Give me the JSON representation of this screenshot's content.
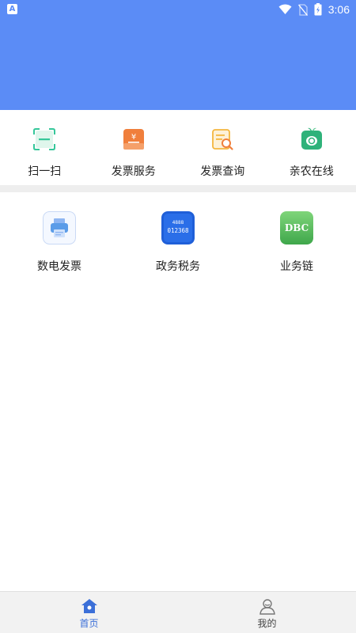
{
  "statusbar": {
    "time": "3:06",
    "left_icon": "A",
    "icons": [
      "wifi-icon",
      "no-sim-icon",
      "battery-charging-icon"
    ]
  },
  "header": {
    "background": "#5b8cf6"
  },
  "quick_actions": [
    {
      "label": "扫一扫",
      "icon": "scan-icon",
      "color": "#35c79a"
    },
    {
      "label": "发票服务",
      "icon": "invoice-service-icon",
      "color": "#f07f3c"
    },
    {
      "label": "发票查询",
      "icon": "invoice-search-icon",
      "color": "#f4b63f"
    },
    {
      "label": "亲农在线",
      "icon": "farm-online-icon",
      "color": "#2fb27a"
    }
  ],
  "services": [
    {
      "label": "数电发票",
      "icon": "printer-icon"
    },
    {
      "label": "政务税务",
      "icon": "tax-affairs-icon",
      "icon_text_top": "4888",
      "icon_text_bottom": "012368"
    },
    {
      "label": "业务链",
      "icon": "dbc-icon",
      "icon_text": "DBC"
    }
  ],
  "tabbar": {
    "items": [
      {
        "label": "首页",
        "icon": "home-icon",
        "active": true
      },
      {
        "label": "我的",
        "icon": "profile-icon",
        "active": false
      }
    ],
    "active_color": "#3b6fd8",
    "inactive_color": "#555555"
  }
}
